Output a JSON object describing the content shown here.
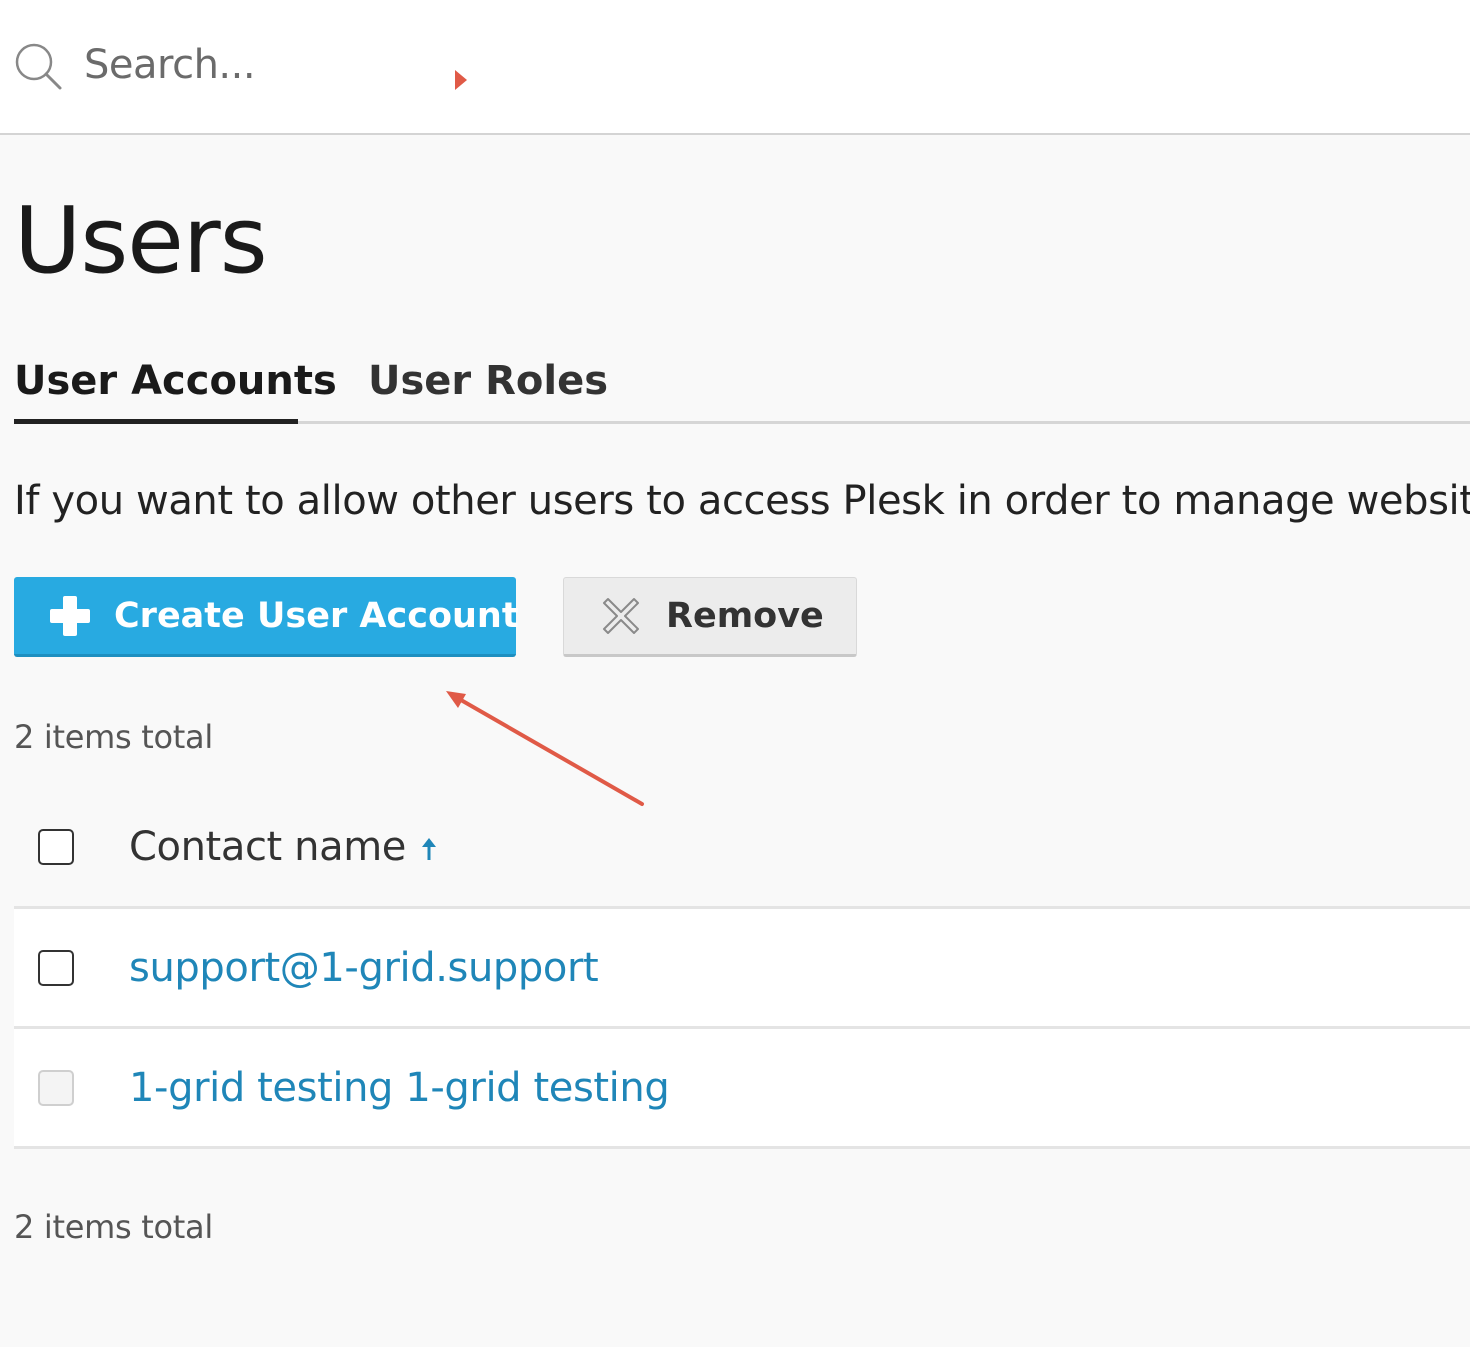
{
  "search": {
    "placeholder": "Search..."
  },
  "page": {
    "title": "Users"
  },
  "tabs": [
    {
      "label": "User Accounts",
      "active": true
    },
    {
      "label": "User Roles",
      "active": false
    }
  ],
  "intro_text": "If you want to allow other users to access Plesk in order to manage websites,",
  "toolbar": {
    "create_label": "Create User Account",
    "remove_label": "Remove"
  },
  "items_total_label": "2 items total",
  "table": {
    "columns": [
      {
        "label": "Contact name",
        "sort": "ascending"
      }
    ],
    "rows": [
      {
        "contact_name": "support@1-grid.support",
        "selectable": true
      },
      {
        "contact_name": "1-grid testing 1-grid testing",
        "selectable": false
      }
    ]
  },
  "colors": {
    "accent": "#28aae1",
    "link": "#1f86b8",
    "annotation": "#e05a47"
  },
  "icons": [
    "search-icon",
    "plus-icon",
    "close-icon",
    "sort-up-icon"
  ]
}
